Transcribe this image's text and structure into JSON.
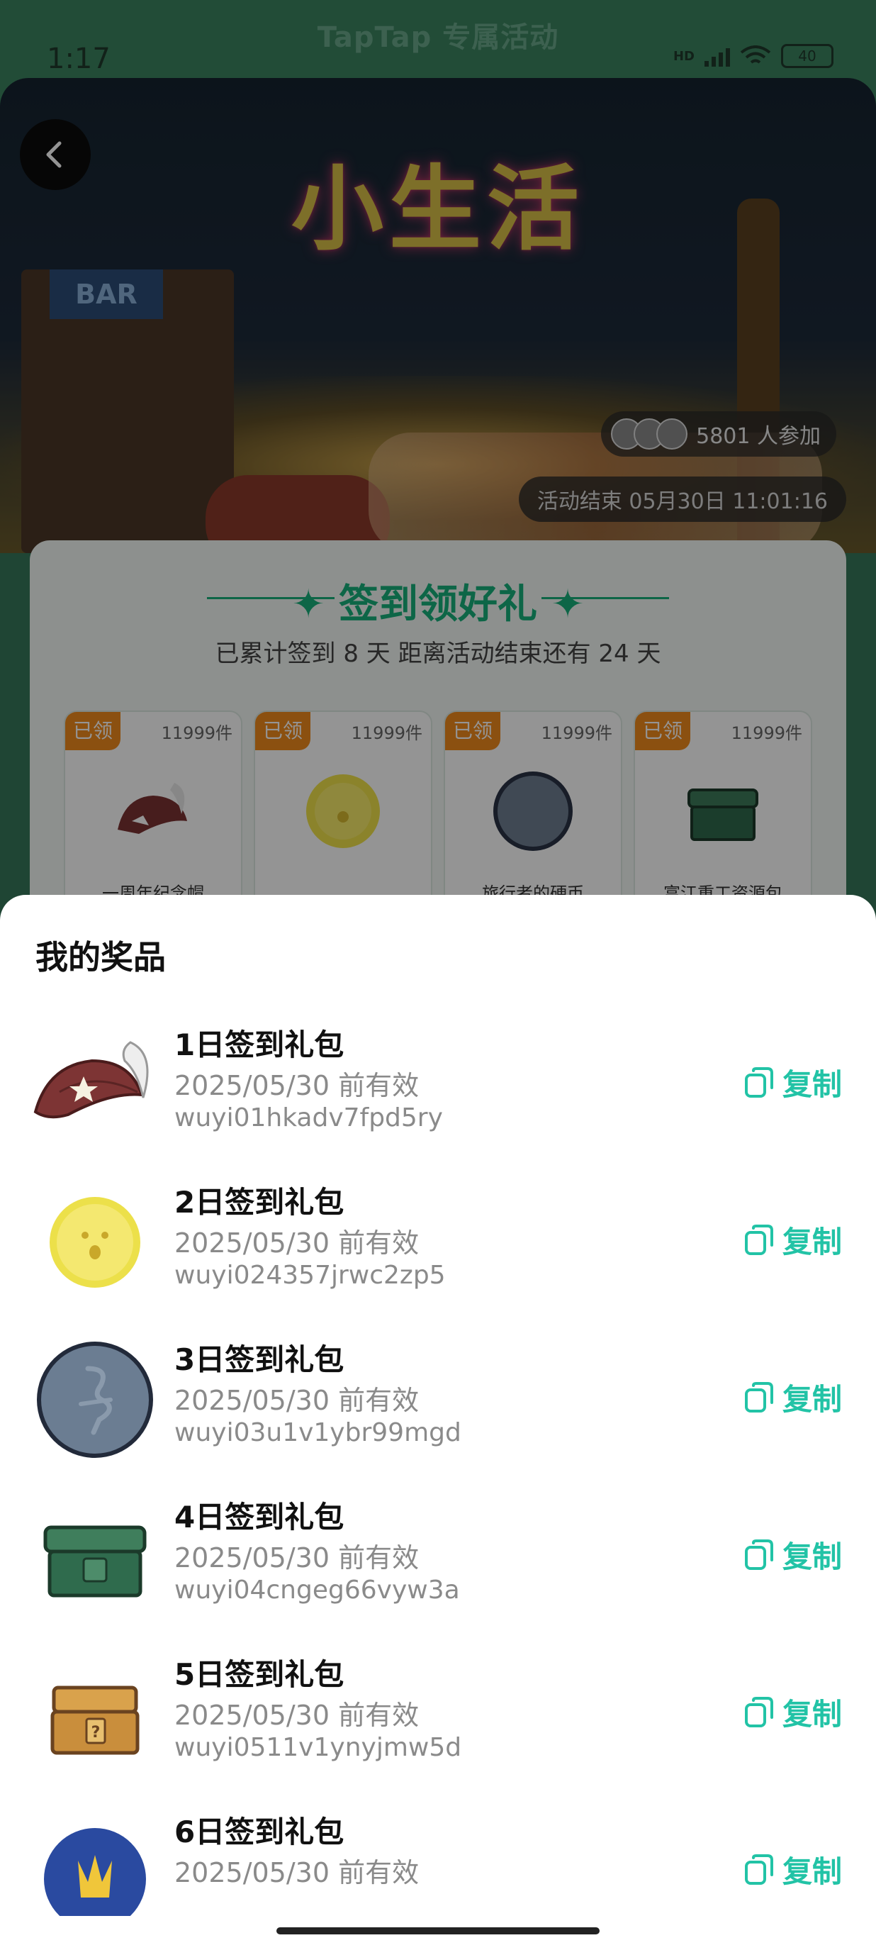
{
  "status_bar": {
    "time": "1:17",
    "brand": "TapTap 专属活动",
    "battery": "40",
    "network": "HD"
  },
  "banner": {
    "title": "小生活",
    "bar_sign": "BAR",
    "participants": "5801 人参加",
    "end_time": "活动结束 05月30日 11:01:16"
  },
  "sign_in": {
    "title": "签到领好礼",
    "subtitle": "已累计签到 8 天  距离活动结束还有 24 天",
    "rewards": [
      {
        "tag": "已领",
        "count": "11999件",
        "name": "一周年纪念帽",
        "icon": "hat-icon"
      },
      {
        "tag": "已领",
        "count": "11999件",
        "name": "",
        "icon": "gold-coin-icon"
      },
      {
        "tag": "已领",
        "count": "11999件",
        "name": "旅行者的硬币",
        "icon": "silver-coin-icon"
      },
      {
        "tag": "已领",
        "count": "11999件",
        "name": "富江重工资源包",
        "icon": "green-chest-icon"
      }
    ]
  },
  "sheet": {
    "title": "我的奖品",
    "copy_label": "复制",
    "prizes": [
      {
        "name": "1日签到礼包",
        "valid": "2025/05/30 前有效",
        "code": "wuyi01hkadv7fpd5ry",
        "icon": "hat-icon"
      },
      {
        "name": "2日签到礼包",
        "valid": "2025/05/30 前有效",
        "code": "wuyi024357jrwc2zp5",
        "icon": "gold-coin-icon"
      },
      {
        "name": "3日签到礼包",
        "valid": "2025/05/30 前有效",
        "code": "wuyi03u1v1ybr99mgd",
        "icon": "silver-coin-icon"
      },
      {
        "name": "4日签到礼包",
        "valid": "2025/05/30 前有效",
        "code": "wuyi04cngeg66vyw3a",
        "icon": "green-chest-icon"
      },
      {
        "name": "5日签到礼包",
        "valid": "2025/05/30 前有效",
        "code": "wuyi0511v1ynyjmw5d",
        "icon": "treasure-box-icon"
      },
      {
        "name": "6日签到礼包",
        "valid": "2025/05/30 前有效",
        "code": "",
        "icon": "trident-badge-icon"
      }
    ]
  },
  "colors": {
    "accent": "#22c3a6",
    "brand_green": "#17b07a",
    "tag_orange": "#f08a1c"
  }
}
